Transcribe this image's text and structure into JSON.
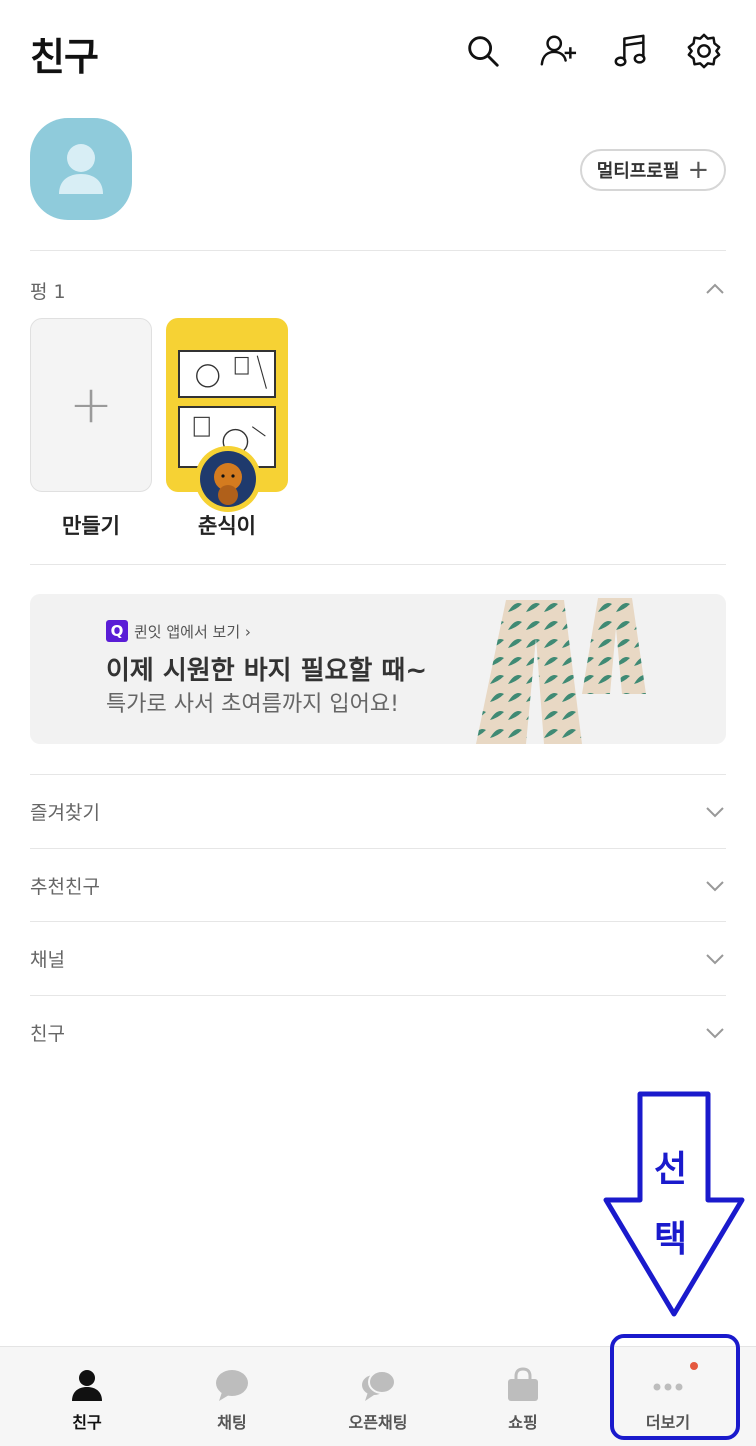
{
  "header": {
    "title": "친구",
    "icons": [
      "search-icon",
      "add-friend-icon",
      "music-icon",
      "settings-icon"
    ]
  },
  "profile": {
    "multi_profile_label": "멀티프로필",
    "multi_profile_plus": "+"
  },
  "stories": {
    "section_label": "펑 1",
    "create_label": "만들기",
    "friend_name": "춘식이"
  },
  "banner": {
    "source_text": "퀸잇 앱에서 보기 ›",
    "source_logo": "Q",
    "title": "이제 시원한 바지 필요할 때~",
    "subtitle": "특가로 사서 초여름까지 입어요!"
  },
  "sections": [
    {
      "label": "즐겨찾기"
    },
    {
      "label": "추천친구"
    },
    {
      "label": "채널"
    },
    {
      "label": "친구"
    }
  ],
  "annotation": {
    "text_1": "선",
    "text_2": "택"
  },
  "tabbar": {
    "tabs": [
      {
        "label": "친구",
        "icon": "person-icon",
        "active": true
      },
      {
        "label": "채팅",
        "icon": "chat-bubble-icon",
        "active": false
      },
      {
        "label": "오픈채팅",
        "icon": "open-chat-icon",
        "active": false
      },
      {
        "label": "쇼핑",
        "icon": "shopping-bag-icon",
        "active": false
      },
      {
        "label": "더보기",
        "icon": "more-dots-icon",
        "active": false
      }
    ]
  },
  "colors": {
    "accent_annotation": "#1a1acc",
    "profile_bg": "#8fcbdb",
    "story_yellow": "#f6d234",
    "notification_dot": "#e5583e",
    "quinit_purple": "#5a1dd6"
  }
}
